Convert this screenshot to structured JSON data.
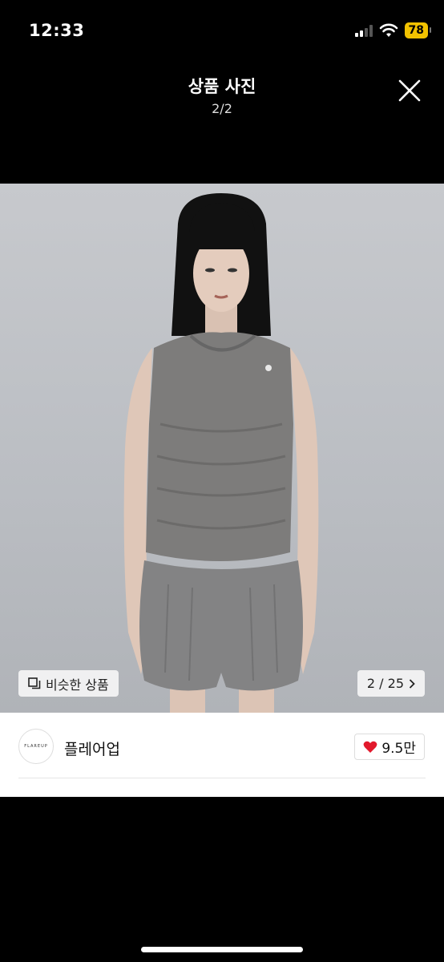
{
  "status_bar": {
    "time": "12:33",
    "battery": "78",
    "battery_color": "#f2c200"
  },
  "header": {
    "title": "상품 사진",
    "counter": "2/2",
    "close_icon": "close-icon"
  },
  "photo": {
    "similar_label": "비슷한 상품",
    "page_counter": "2 / 25"
  },
  "store": {
    "logo_text": "FLAREUP",
    "name": "플레어업",
    "likes": "9.5만",
    "heart_color": "#e2192c"
  }
}
